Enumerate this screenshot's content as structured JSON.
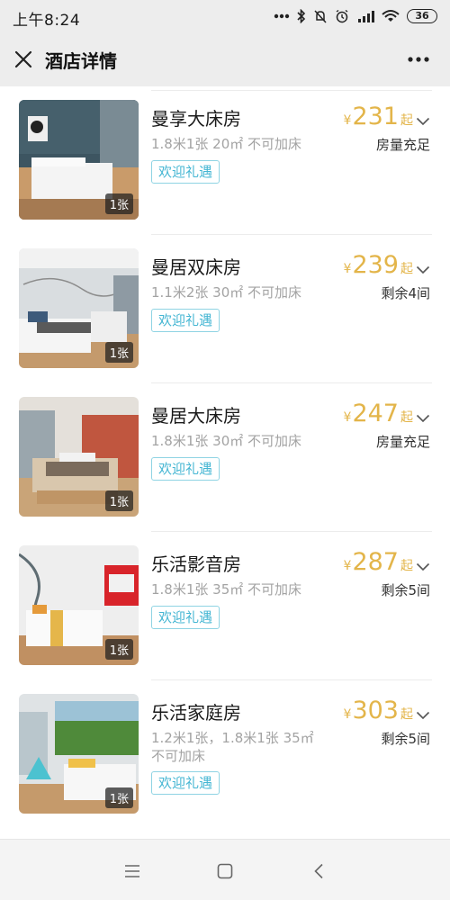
{
  "status": {
    "time": "上午8:24",
    "battery": "36"
  },
  "header": {
    "title": "酒店详情"
  },
  "rooms": [
    {
      "name": "曼享大床房",
      "spec": "1.8米1张 20㎡ 不可加床",
      "tag": "欢迎礼遇",
      "yen": "¥",
      "price": "231",
      "price_suffix": "起",
      "stock": "房量充足",
      "beds": "1张"
    },
    {
      "name": "曼居双床房",
      "spec": "1.1米2张 30㎡ 不可加床",
      "tag": "欢迎礼遇",
      "yen": "¥",
      "price": "239",
      "price_suffix": "起",
      "stock": "剩余4间",
      "beds": "1张"
    },
    {
      "name": "曼居大床房",
      "spec": "1.8米1张 30㎡ 不可加床",
      "tag": "欢迎礼遇",
      "yen": "¥",
      "price": "247",
      "price_suffix": "起",
      "stock": "房量充足",
      "beds": "1张"
    },
    {
      "name": "乐活影音房",
      "spec": "1.8米1张 35㎡ 不可加床",
      "tag": "欢迎礼遇",
      "yen": "¥",
      "price": "287",
      "price_suffix": "起",
      "stock": "剩余5间",
      "beds": "1张"
    },
    {
      "name": "乐活家庭房",
      "spec": "1.2米1张，1.8米1张 35㎡ 不可加床",
      "tag": "欢迎礼遇",
      "yen": "¥",
      "price": "303",
      "price_suffix": "起",
      "stock": "剩余5间",
      "beds": "1张"
    }
  ],
  "colors": {
    "price": "#e3b54a",
    "tag": "#45b6d3",
    "header_bg": "#ededed"
  }
}
